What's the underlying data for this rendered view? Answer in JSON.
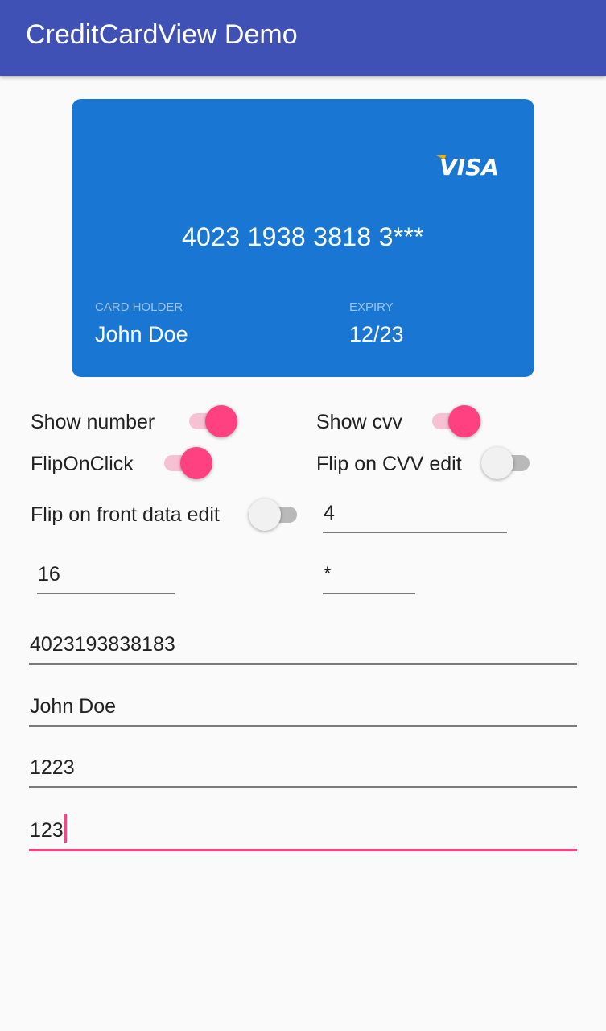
{
  "app": {
    "title": "CreditCardView Demo",
    "primary_color": "#3f51b5",
    "accent_color": "#ff4081"
  },
  "card": {
    "brand": "VISA",
    "brand_icon": "visa-logo",
    "background_color": "#1976d2",
    "number": "4023 1938 3818 3***",
    "holder_label": "CARD HOLDER",
    "holder_value": "John Doe",
    "expiry_label": "EXPIRY",
    "expiry_value": "12/23"
  },
  "options": {
    "show_number": {
      "label": "Show number",
      "checked": true
    },
    "show_cvv": {
      "label": "Show cvv",
      "checked": true
    },
    "flip_on_click": {
      "label": "FlipOnClick",
      "checked": true
    },
    "flip_on_cvv_edit": {
      "label": "Flip on CVV edit",
      "checked": false
    },
    "flip_on_front_data_edit": {
      "label": "Flip on front data edit",
      "checked": false
    }
  },
  "inputs": {
    "group_size": "4",
    "max_length": "16",
    "mask_char": "*",
    "card_number": "4023193838183",
    "card_holder": "John Doe",
    "expiry": "1223",
    "cvv": "123"
  }
}
